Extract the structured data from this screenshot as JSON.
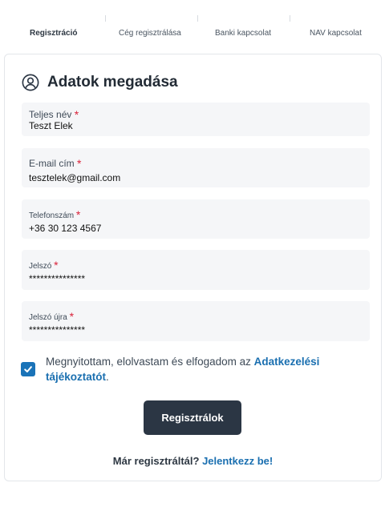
{
  "stepper": {
    "steps": [
      {
        "label": "Regisztráció",
        "active": true
      },
      {
        "label": "Cég regisztrálása",
        "active": false
      },
      {
        "label": "Banki kapcsolat",
        "active": false
      },
      {
        "label": "NAV kapcsolat",
        "active": false
      }
    ]
  },
  "form": {
    "title": "Adatok megadása",
    "title_icon": "user-circle-icon",
    "required_mark": "*",
    "fields": [
      {
        "label": "Teljes név",
        "value": "Teszt Elek"
      },
      {
        "label": "E-mail cím",
        "value": "tesztelek@gmail.com"
      },
      {
        "label": "Telefonszám",
        "value": "+36 30 123 4567"
      },
      {
        "label": "Jelszó",
        "value": "***************"
      },
      {
        "label": "Jelszó újra",
        "value": "***************"
      }
    ],
    "consent": {
      "checked": true,
      "text_before": "Megnyitottam, elolvastam és elfogadom az ",
      "link_text": "Adatkezelési tájékoztatót",
      "text_after": "."
    },
    "submit_label": "Regisztrálok",
    "login_prompt": "Már regisztráltál?",
    "login_link": "Jelentkezz be!"
  },
  "colors": {
    "accent": "#1a73b8",
    "link": "#1a6fb0",
    "button": "#2b3644",
    "required": "#d9223a",
    "field_bg": "#f5f6f8"
  }
}
